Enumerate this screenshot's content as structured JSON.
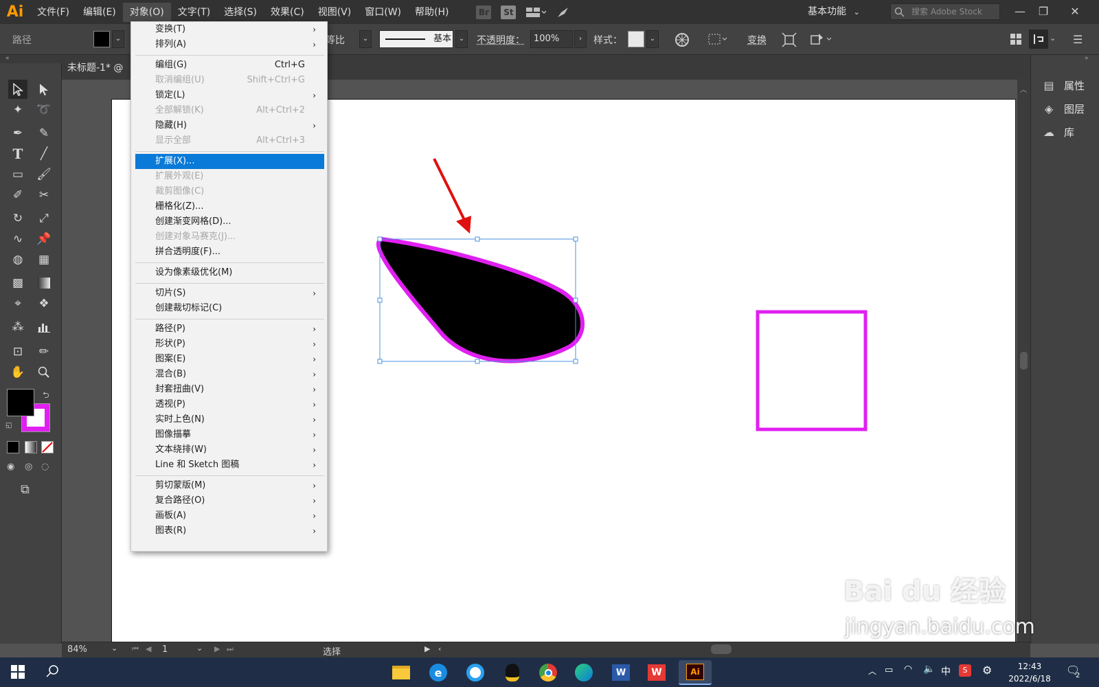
{
  "app": {
    "logo": "Ai"
  },
  "menubar": {
    "items": [
      "文件(F)",
      "编辑(E)",
      "对象(O)",
      "文字(T)",
      "选择(S)",
      "效果(C)",
      "视图(V)",
      "窗口(W)",
      "帮助(H)"
    ],
    "icons": [
      "Br",
      "St"
    ],
    "workspace": "基本功能",
    "search_placeholder": "搜索 Adobe Stock"
  },
  "controlbar": {
    "object_type": "路径",
    "ratio_label": "等比",
    "stroke_profile": "基本",
    "opacity_label": "不透明度：",
    "opacity_value": "100%",
    "style_label": "样式：",
    "transform_label": "变换"
  },
  "document": {
    "tab_title": "未标题-1* @"
  },
  "right_panel": {
    "items": [
      "属性",
      "图层",
      "库"
    ]
  },
  "statusbar": {
    "zoom": "84%",
    "artboard": "1",
    "tool": "选择"
  },
  "object_menu": {
    "items": [
      {
        "label": "变换(T)",
        "shortcut": "",
        "submenu": true,
        "disabled": false
      },
      {
        "label": "排列(A)",
        "shortcut": "",
        "submenu": true,
        "disabled": false
      },
      {
        "label": "编组(G)",
        "shortcut": "Ctrl+G",
        "submenu": false,
        "disabled": false
      },
      {
        "label": "取消编组(U)",
        "shortcut": "Shift+Ctrl+G",
        "submenu": false,
        "disabled": true
      },
      {
        "label": "锁定(L)",
        "shortcut": "",
        "submenu": true,
        "disabled": false
      },
      {
        "label": "全部解锁(K)",
        "shortcut": "Alt+Ctrl+2",
        "submenu": false,
        "disabled": true
      },
      {
        "label": "隐藏(H)",
        "shortcut": "",
        "submenu": true,
        "disabled": false
      },
      {
        "label": "显示全部",
        "shortcut": "Alt+Ctrl+3",
        "submenu": false,
        "disabled": true
      },
      {
        "label": "扩展(X)...",
        "shortcut": "",
        "submenu": false,
        "disabled": false,
        "highlighted": true
      },
      {
        "label": "扩展外观(E)",
        "shortcut": "",
        "submenu": false,
        "disabled": true
      },
      {
        "label": "裁剪图像(C)",
        "shortcut": "",
        "submenu": false,
        "disabled": true
      },
      {
        "label": "栅格化(Z)...",
        "shortcut": "",
        "submenu": false,
        "disabled": false
      },
      {
        "label": "创建渐变网格(D)...",
        "shortcut": "",
        "submenu": false,
        "disabled": false
      },
      {
        "label": "创建对象马赛克(J)...",
        "shortcut": "",
        "submenu": false,
        "disabled": true
      },
      {
        "label": "拼合透明度(F)...",
        "shortcut": "",
        "submenu": false,
        "disabled": false
      },
      {
        "label": "设为像素级优化(M)",
        "shortcut": "",
        "submenu": false,
        "disabled": false
      },
      {
        "label": "切片(S)",
        "shortcut": "",
        "submenu": true,
        "disabled": false
      },
      {
        "label": "创建裁切标记(C)",
        "shortcut": "",
        "submenu": false,
        "disabled": false
      },
      {
        "label": "路径(P)",
        "shortcut": "",
        "submenu": true,
        "disabled": false
      },
      {
        "label": "形状(P)",
        "shortcut": "",
        "submenu": true,
        "disabled": false
      },
      {
        "label": "图案(E)",
        "shortcut": "",
        "submenu": true,
        "disabled": false
      },
      {
        "label": "混合(B)",
        "shortcut": "",
        "submenu": true,
        "disabled": false
      },
      {
        "label": "封套扭曲(V)",
        "shortcut": "",
        "submenu": true,
        "disabled": false
      },
      {
        "label": "透视(P)",
        "shortcut": "",
        "submenu": true,
        "disabled": false
      },
      {
        "label": "实时上色(N)",
        "shortcut": "",
        "submenu": true,
        "disabled": false
      },
      {
        "label": "图像描摹",
        "shortcut": "",
        "submenu": true,
        "disabled": false
      },
      {
        "label": "文本绕排(W)",
        "shortcut": "",
        "submenu": true,
        "disabled": false
      },
      {
        "label": "Line 和 Sketch 图稿",
        "shortcut": "",
        "submenu": true,
        "disabled": false
      },
      {
        "label": "剪切蒙版(M)",
        "shortcut": "",
        "submenu": true,
        "disabled": false
      },
      {
        "label": "复合路径(O)",
        "shortcut": "",
        "submenu": true,
        "disabled": false
      },
      {
        "label": "画板(A)",
        "shortcut": "",
        "submenu": true,
        "disabled": false
      },
      {
        "label": "图表(R)",
        "shortcut": "",
        "submenu": true,
        "disabled": false
      }
    ]
  },
  "taskbar": {
    "time": "12:43",
    "date": "2022/6/18",
    "ime": "中",
    "notification_count": "2"
  },
  "watermark": {
    "brand": "Bai du 经验",
    "url": "jingyan.baidu.com"
  },
  "colors": {
    "accent": "#0a7ad8",
    "stroke": "#e020f0",
    "fill": "#000000",
    "annotation": "#e01010",
    "selection": "#4a90e0"
  }
}
